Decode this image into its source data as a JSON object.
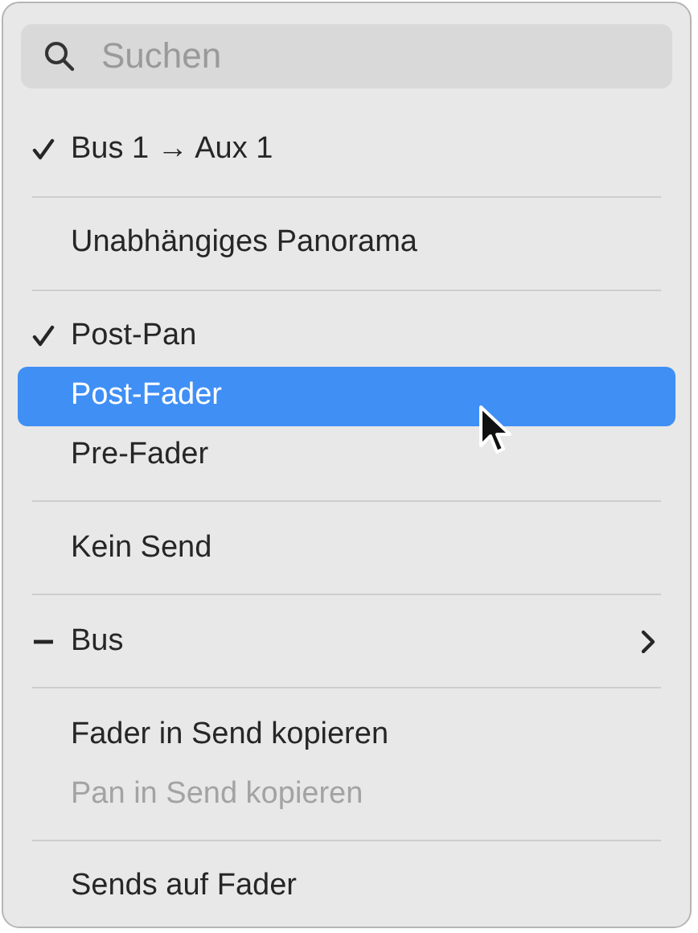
{
  "search": {
    "placeholder": "Suchen"
  },
  "items": [
    {
      "kind": "item",
      "label": "Bus 1 → Aux 1",
      "checked": true,
      "mixed": false,
      "selected": false,
      "disabled": false,
      "submenu": false
    },
    {
      "kind": "separator"
    },
    {
      "kind": "item",
      "label": "Unabhängiges Panorama",
      "checked": false,
      "mixed": false,
      "selected": false,
      "disabled": false,
      "submenu": false
    },
    {
      "kind": "separator"
    },
    {
      "kind": "item",
      "label": "Post-Pan",
      "checked": true,
      "mixed": false,
      "selected": false,
      "disabled": false,
      "submenu": false
    },
    {
      "kind": "item",
      "label": "Post-Fader",
      "checked": false,
      "mixed": false,
      "selected": true,
      "disabled": false,
      "submenu": false
    },
    {
      "kind": "item",
      "label": "Pre-Fader",
      "checked": false,
      "mixed": false,
      "selected": false,
      "disabled": false,
      "submenu": false
    },
    {
      "kind": "separator"
    },
    {
      "kind": "item",
      "label": "Kein Send",
      "checked": false,
      "mixed": false,
      "selected": false,
      "disabled": false,
      "submenu": false
    },
    {
      "kind": "separator"
    },
    {
      "kind": "item",
      "label": "Bus",
      "checked": false,
      "mixed": true,
      "selected": false,
      "disabled": false,
      "submenu": true
    },
    {
      "kind": "separator"
    },
    {
      "kind": "item",
      "label": "Fader in Send kopieren",
      "checked": false,
      "mixed": false,
      "selected": false,
      "disabled": false,
      "submenu": false
    },
    {
      "kind": "item",
      "label": "Pan in Send kopieren",
      "checked": false,
      "mixed": false,
      "selected": false,
      "disabled": true,
      "submenu": false
    },
    {
      "kind": "separator"
    },
    {
      "kind": "item",
      "label": "Sends auf Fader",
      "checked": false,
      "mixed": false,
      "selected": false,
      "disabled": false,
      "submenu": false
    }
  ]
}
